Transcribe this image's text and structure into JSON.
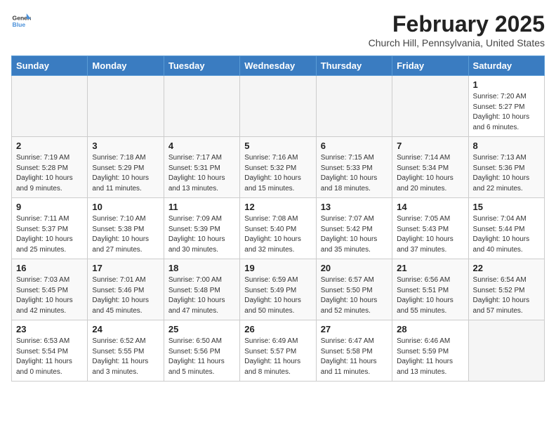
{
  "header": {
    "logo_general": "General",
    "logo_blue": "Blue",
    "month_title": "February 2025",
    "location": "Church Hill, Pennsylvania, United States"
  },
  "weekdays": [
    "Sunday",
    "Monday",
    "Tuesday",
    "Wednesday",
    "Thursday",
    "Friday",
    "Saturday"
  ],
  "weeks": [
    [
      {
        "day": "",
        "info": ""
      },
      {
        "day": "",
        "info": ""
      },
      {
        "day": "",
        "info": ""
      },
      {
        "day": "",
        "info": ""
      },
      {
        "day": "",
        "info": ""
      },
      {
        "day": "",
        "info": ""
      },
      {
        "day": "1",
        "info": "Sunrise: 7:20 AM\nSunset: 5:27 PM\nDaylight: 10 hours and 6 minutes."
      }
    ],
    [
      {
        "day": "2",
        "info": "Sunrise: 7:19 AM\nSunset: 5:28 PM\nDaylight: 10 hours and 9 minutes."
      },
      {
        "day": "3",
        "info": "Sunrise: 7:18 AM\nSunset: 5:29 PM\nDaylight: 10 hours and 11 minutes."
      },
      {
        "day": "4",
        "info": "Sunrise: 7:17 AM\nSunset: 5:31 PM\nDaylight: 10 hours and 13 minutes."
      },
      {
        "day": "5",
        "info": "Sunrise: 7:16 AM\nSunset: 5:32 PM\nDaylight: 10 hours and 15 minutes."
      },
      {
        "day": "6",
        "info": "Sunrise: 7:15 AM\nSunset: 5:33 PM\nDaylight: 10 hours and 18 minutes."
      },
      {
        "day": "7",
        "info": "Sunrise: 7:14 AM\nSunset: 5:34 PM\nDaylight: 10 hours and 20 minutes."
      },
      {
        "day": "8",
        "info": "Sunrise: 7:13 AM\nSunset: 5:36 PM\nDaylight: 10 hours and 22 minutes."
      }
    ],
    [
      {
        "day": "9",
        "info": "Sunrise: 7:11 AM\nSunset: 5:37 PM\nDaylight: 10 hours and 25 minutes."
      },
      {
        "day": "10",
        "info": "Sunrise: 7:10 AM\nSunset: 5:38 PM\nDaylight: 10 hours and 27 minutes."
      },
      {
        "day": "11",
        "info": "Sunrise: 7:09 AM\nSunset: 5:39 PM\nDaylight: 10 hours and 30 minutes."
      },
      {
        "day": "12",
        "info": "Sunrise: 7:08 AM\nSunset: 5:40 PM\nDaylight: 10 hours and 32 minutes."
      },
      {
        "day": "13",
        "info": "Sunrise: 7:07 AM\nSunset: 5:42 PM\nDaylight: 10 hours and 35 minutes."
      },
      {
        "day": "14",
        "info": "Sunrise: 7:05 AM\nSunset: 5:43 PM\nDaylight: 10 hours and 37 minutes."
      },
      {
        "day": "15",
        "info": "Sunrise: 7:04 AM\nSunset: 5:44 PM\nDaylight: 10 hours and 40 minutes."
      }
    ],
    [
      {
        "day": "16",
        "info": "Sunrise: 7:03 AM\nSunset: 5:45 PM\nDaylight: 10 hours and 42 minutes."
      },
      {
        "day": "17",
        "info": "Sunrise: 7:01 AM\nSunset: 5:46 PM\nDaylight: 10 hours and 45 minutes."
      },
      {
        "day": "18",
        "info": "Sunrise: 7:00 AM\nSunset: 5:48 PM\nDaylight: 10 hours and 47 minutes."
      },
      {
        "day": "19",
        "info": "Sunrise: 6:59 AM\nSunset: 5:49 PM\nDaylight: 10 hours and 50 minutes."
      },
      {
        "day": "20",
        "info": "Sunrise: 6:57 AM\nSunset: 5:50 PM\nDaylight: 10 hours and 52 minutes."
      },
      {
        "day": "21",
        "info": "Sunrise: 6:56 AM\nSunset: 5:51 PM\nDaylight: 10 hours and 55 minutes."
      },
      {
        "day": "22",
        "info": "Sunrise: 6:54 AM\nSunset: 5:52 PM\nDaylight: 10 hours and 57 minutes."
      }
    ],
    [
      {
        "day": "23",
        "info": "Sunrise: 6:53 AM\nSunset: 5:54 PM\nDaylight: 11 hours and 0 minutes."
      },
      {
        "day": "24",
        "info": "Sunrise: 6:52 AM\nSunset: 5:55 PM\nDaylight: 11 hours and 3 minutes."
      },
      {
        "day": "25",
        "info": "Sunrise: 6:50 AM\nSunset: 5:56 PM\nDaylight: 11 hours and 5 minutes."
      },
      {
        "day": "26",
        "info": "Sunrise: 6:49 AM\nSunset: 5:57 PM\nDaylight: 11 hours and 8 minutes."
      },
      {
        "day": "27",
        "info": "Sunrise: 6:47 AM\nSunset: 5:58 PM\nDaylight: 11 hours and 11 minutes."
      },
      {
        "day": "28",
        "info": "Sunrise: 6:46 AM\nSunset: 5:59 PM\nDaylight: 11 hours and 13 minutes."
      },
      {
        "day": "",
        "info": ""
      }
    ]
  ]
}
